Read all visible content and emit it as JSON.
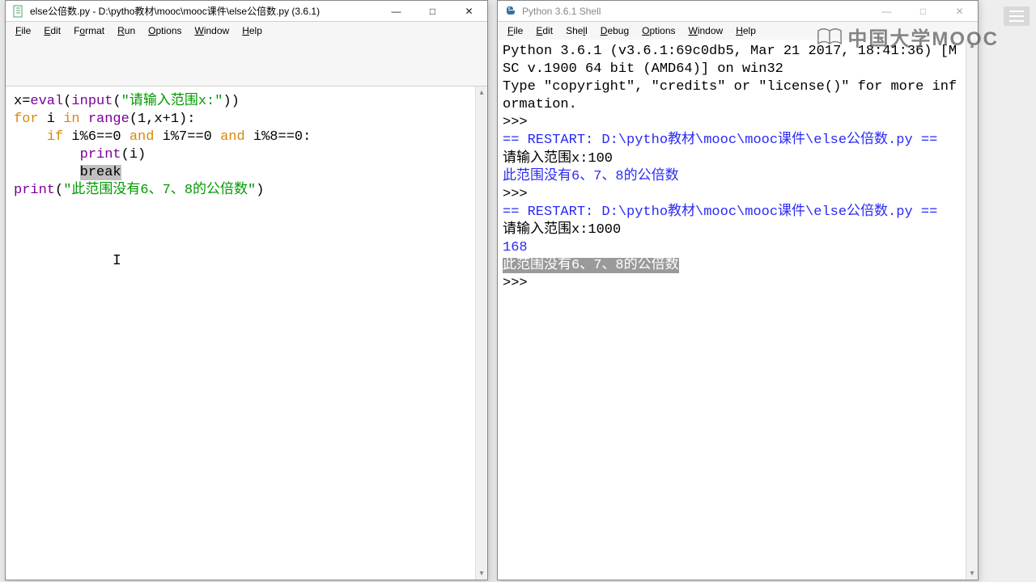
{
  "editor": {
    "title": "else公倍数.py - D:\\pytho教材\\mooc\\mooc课件\\else公倍数.py (3.6.1)",
    "menu": [
      "File",
      "Edit",
      "Format",
      "Run",
      "Options",
      "Window",
      "Help"
    ],
    "code": {
      "l1_a": "x=",
      "l1_eval": "eval",
      "l1_b": "(",
      "l1_input": "input",
      "l1_c": "(",
      "l1_str": "\"请输入范围x:\"",
      "l1_d": "))",
      "l2_for": "for",
      "l2_a": " i ",
      "l2_in": "in",
      "l2_b": " ",
      "l2_range": "range",
      "l2_c": "(1,x+1):",
      "l3_indent": "    ",
      "l3_if": "if",
      "l3_a": " i%6==0 ",
      "l3_and1": "and",
      "l3_b": " i%7==0 ",
      "l3_and2": "and",
      "l3_c": " i%8==0:",
      "l4_indent": "        ",
      "l4_print": "print",
      "l4_a": "(i)",
      "l5_indent": "        ",
      "l5_break": "break",
      "l6_print": "print",
      "l6_a": "(",
      "l6_str": "\"此范围没有6、7、8的公倍数\"",
      "l6_b": ")"
    }
  },
  "shell": {
    "title": "Python 3.6.1 Shell",
    "menu": [
      "File",
      "Edit",
      "Shell",
      "Debug",
      "Options",
      "Window",
      "Help"
    ],
    "banner1": "Python 3.6.1 (v3.6.1:69c0db5, Mar 21 2017, 18:41:36) [MSC v.1900 64 bit (AMD64)] on win32",
    "banner2": "Type \"copyright\", \"credits\" or \"license()\" for more information.",
    "prompt": ">>> ",
    "restart1": "== RESTART: D:\\pytho教材\\mooc\\mooc课件\\else公倍数.py ==",
    "input_label": "请输入范围x:",
    "run1_input": "100",
    "run1_out": "此范围没有6、7、8的公倍数",
    "run2_input": "1000",
    "run2_out1": "168",
    "run2_out2": "此范围没有6、7、8的公倍数"
  },
  "controls": {
    "min": "—",
    "max": "□",
    "close": "✕"
  },
  "watermark": "中国大学MOOC"
}
